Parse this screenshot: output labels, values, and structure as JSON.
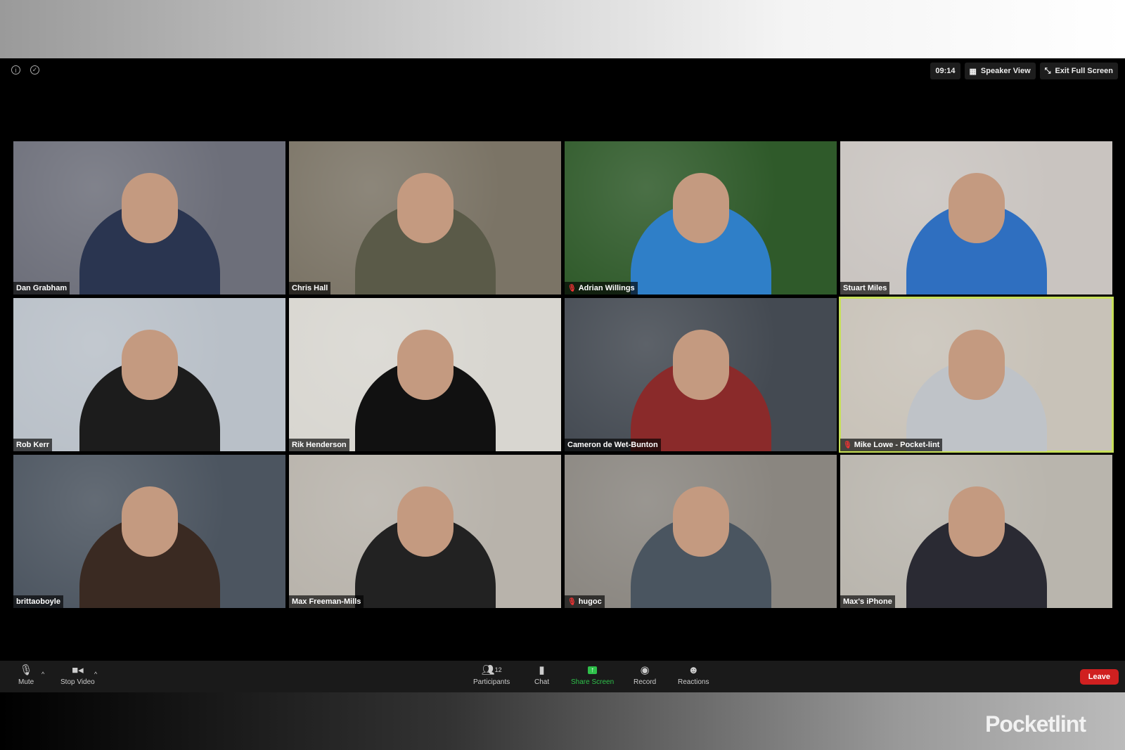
{
  "header": {
    "time": "09:14",
    "speaker_view": "Speaker View",
    "exit_full_screen": "Exit Full Screen"
  },
  "participants": [
    {
      "name": "Dan Grabham",
      "muted": false,
      "bg": "#6d6f7a",
      "shirt": "#2a3550"
    },
    {
      "name": "Chris Hall",
      "muted": false,
      "bg": "#7b7466",
      "shirt": "#5a5a48"
    },
    {
      "name": "Adrian Willings",
      "muted": true,
      "bg": "#2f5a2a",
      "shirt": "#2f7fc8"
    },
    {
      "name": "Stuart Miles",
      "muted": false,
      "bg": "#c9c4c0",
      "shirt": "#2f6fc0"
    },
    {
      "name": "Rob Kerr",
      "muted": false,
      "bg": "#b9c0c8",
      "shirt": "#1c1c1c"
    },
    {
      "name": "Rik Henderson",
      "muted": false,
      "bg": "#d8d6d0",
      "shirt": "#111"
    },
    {
      "name": "Cameron de Wet-Bunton",
      "muted": false,
      "bg": "#444a52",
      "shirt": "#8a2a2a"
    },
    {
      "name": "Mike Lowe - Pocket-lint",
      "muted": true,
      "active": true,
      "bg": "#c8c2b8",
      "shirt": "#bfc3c8"
    },
    {
      "name": "brittaoboyle",
      "muted": false,
      "bg": "#4c5560",
      "shirt": "#3a2a22"
    },
    {
      "name": "Max Freeman-Mills",
      "muted": false,
      "bg": "#b8b3ab",
      "shirt": "#222"
    },
    {
      "name": "hugoc",
      "muted": true,
      "bg": "#8a8680",
      "shirt": "#4a5560"
    },
    {
      "name": "Max's iPhone",
      "muted": false,
      "bg": "#b9b5ad",
      "shirt": "#2a2a33"
    }
  ],
  "toolbar": {
    "mute": "Mute",
    "stop_video": "Stop Video",
    "participants": "Participants",
    "participants_count": "12",
    "chat": "Chat",
    "share_screen": "Share Screen",
    "record": "Record",
    "reactions": "Reactions",
    "leave": "Leave",
    "share_color": "#2ec04a",
    "leave_color": "#d02020"
  },
  "watermark": "Pocketlint"
}
